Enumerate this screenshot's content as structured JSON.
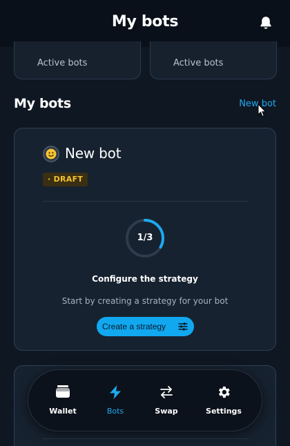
{
  "header": {
    "title": "My bots",
    "bell_icon": "bell-icon"
  },
  "stats": [
    {
      "label": "Active bots"
    },
    {
      "label": "Active bots"
    }
  ],
  "section": {
    "title": "My bots",
    "new_bot_label": "New bot"
  },
  "bot_card": {
    "name": "New bot",
    "avatar_icon": "smiley-icon",
    "status": "· DRAFT",
    "progress_text": "1/3",
    "progress_value": 0.333,
    "step_title": "Configure the strategy",
    "step_description": "Start by creating a strategy for your bot",
    "create_button_label": "Create a strategy",
    "create_button_icon": "sliders-icon"
  },
  "nav": {
    "items": [
      {
        "label": "Wallet",
        "icon": "wallet-icon"
      },
      {
        "label": "Bots",
        "icon": "lightning-icon",
        "active": true
      },
      {
        "label": "Swap",
        "icon": "swap-arrows-icon"
      },
      {
        "label": "Settings",
        "icon": "gear-icon"
      }
    ]
  },
  "colors": {
    "accent": "#1eaaf1",
    "draft": "#f1c233",
    "background": "#0f1722",
    "card": "#172230"
  }
}
